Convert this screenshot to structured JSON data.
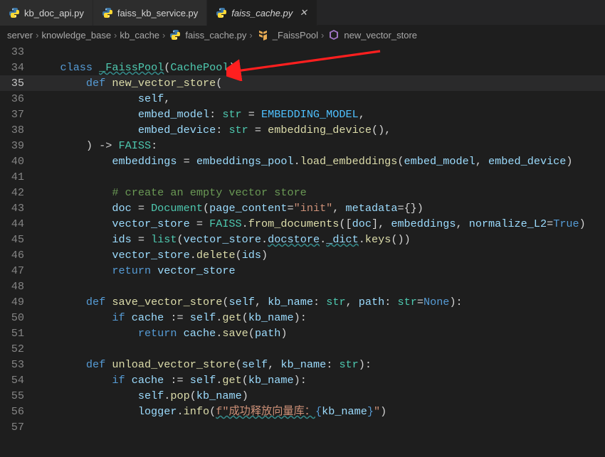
{
  "tabs": [
    {
      "label": "kb_doc_api.py",
      "active": false
    },
    {
      "label": "faiss_kb_service.py",
      "active": false
    },
    {
      "label": "faiss_cache.py",
      "active": true
    }
  ],
  "breadcrumb": {
    "parts": [
      "server",
      "knowledge_base",
      "kb_cache",
      "faiss_cache.py",
      "_FaissPool",
      "new_vector_store"
    ]
  },
  "lines": {
    "n33": "33",
    "n34": "34",
    "n35": "35",
    "n36": "36",
    "n37": "37",
    "n38": "38",
    "n39": "39",
    "n40": "40",
    "n41": "41",
    "n42": "42",
    "n43": "43",
    "n44": "44",
    "n45": "45",
    "n46": "46",
    "n47": "47",
    "n48": "48",
    "n49": "49",
    "n50": "50",
    "n51": "51",
    "n52": "52",
    "n53": "53",
    "n54": "54",
    "n55": "55",
    "n56": "56",
    "n57": "57"
  },
  "code": {
    "c34a": "class ",
    "c34b": "_FaissPool",
    "c34c": "(",
    "c34d": "CachePool",
    "c34e": "):",
    "c35a": "def ",
    "c35b": "new_vector_store",
    "c35c": "(",
    "c36a": "self",
    "c36b": ",",
    "c37a": "embed_model",
    "c37b": ": ",
    "c37c": "str",
    "c37d": " = ",
    "c37e": "EMBEDDING_MODEL",
    "c37f": ",",
    "c38a": "embed_device",
    "c38b": ": ",
    "c38c": "str",
    "c38d": " = ",
    "c38e": "embedding_device",
    "c38f": "(),",
    "c39a": ") -> ",
    "c39b": "FAISS",
    "c39c": ":",
    "c40a": "embeddings",
    "c40b": " = ",
    "c40c": "embeddings_pool",
    "c40d": ".",
    "c40e": "load_embeddings",
    "c40f": "(",
    "c40g": "embed_model",
    "c40h": ", ",
    "c40i": "embed_device",
    "c40j": ")",
    "c42a": "# create an empty vector store",
    "c43a": "doc",
    "c43b": " = ",
    "c43c": "Document",
    "c43d": "(",
    "c43e": "page_content",
    "c43f": "=",
    "c43g": "\"init\"",
    "c43h": ", ",
    "c43i": "metadata",
    "c43j": "={})",
    "c44a": "vector_store",
    "c44b": " = ",
    "c44c": "FAISS",
    "c44d": ".",
    "c44e": "from_documents",
    "c44f": "([",
    "c44g": "doc",
    "c44h": "], ",
    "c44i": "embeddings",
    "c44j": ", ",
    "c44k": "normalize_L2",
    "c44l": "=",
    "c44m": "True",
    "c44n": ")",
    "c45a": "ids",
    "c45b": " = ",
    "c45c": "list",
    "c45d": "(",
    "c45e": "vector_store",
    "c45f": ".",
    "c45g": "docstore",
    "c45h": ".",
    "c45i": "_dict",
    "c45j": ".",
    "c45k": "keys",
    "c45l": "())",
    "c46a": "vector_store",
    "c46b": ".",
    "c46c": "delete",
    "c46d": "(",
    "c46e": "ids",
    "c46f": ")",
    "c47a": "return ",
    "c47b": "vector_store",
    "c49a": "def ",
    "c49b": "save_vector_store",
    "c49c": "(",
    "c49d": "self",
    "c49e": ", ",
    "c49f": "kb_name",
    "c49g": ": ",
    "c49h": "str",
    "c49i": ", ",
    "c49j": "path",
    "c49k": ": ",
    "c49l": "str",
    "c49m": "=",
    "c49n": "None",
    "c49o": "):",
    "c50a": "if ",
    "c50b": "cache",
    "c50c": " := ",
    "c50d": "self",
    "c50e": ".",
    "c50f": "get",
    "c50g": "(",
    "c50h": "kb_name",
    "c50i": "):",
    "c51a": "return ",
    "c51b": "cache",
    "c51c": ".",
    "c51d": "save",
    "c51e": "(",
    "c51f": "path",
    "c51g": ")",
    "c53a": "def ",
    "c53b": "unload_vector_store",
    "c53c": "(",
    "c53d": "self",
    "c53e": ", ",
    "c53f": "kb_name",
    "c53g": ": ",
    "c53h": "str",
    "c53i": "):",
    "c54a": "if ",
    "c54b": "cache",
    "c54c": " := ",
    "c54d": "self",
    "c54e": ".",
    "c54f": "get",
    "c54g": "(",
    "c54h": "kb_name",
    "c54i": "):",
    "c55a": "self",
    "c55b": ".",
    "c55c": "pop",
    "c55d": "(",
    "c55e": "kb_name",
    "c55f": ")",
    "c56a": "logger",
    "c56b": ".",
    "c56c": "info",
    "c56d": "(",
    "c56e": "f\"成功释放向量库：",
    "c56f": "{",
    "c56g": "kb_name",
    "c56h": "}",
    "c56i": "\"",
    "c56j": ")"
  }
}
